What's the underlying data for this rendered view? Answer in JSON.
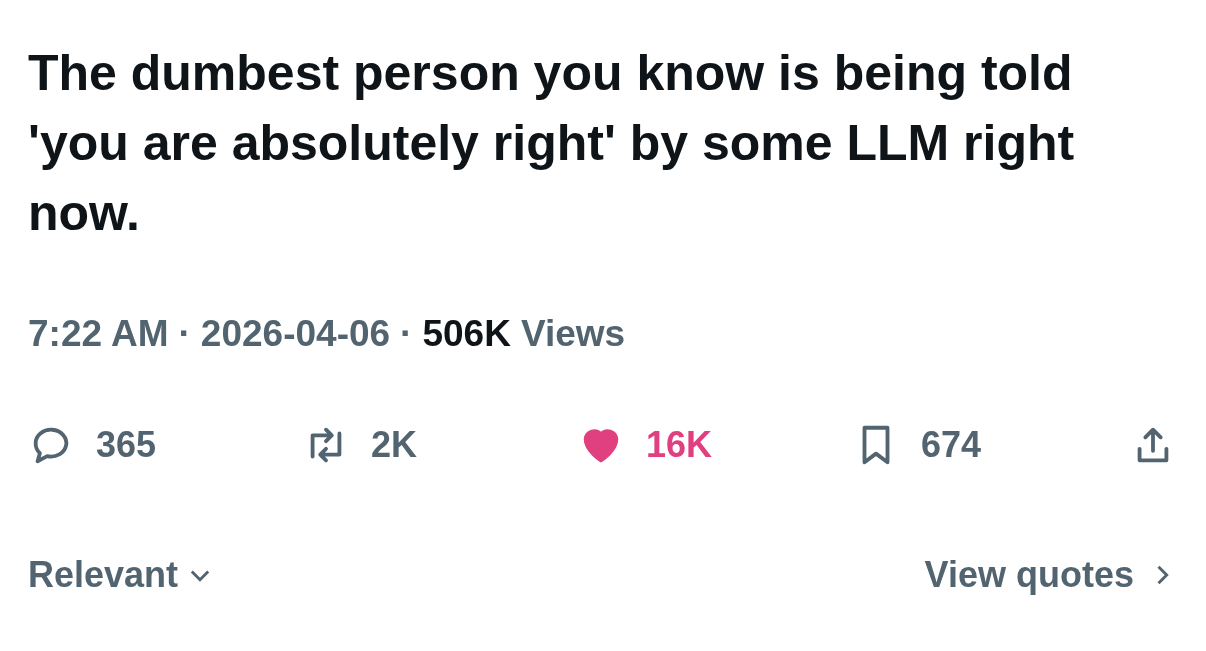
{
  "tweet": {
    "text": "The dumbest person you know is being told 'you are absolutely right' by some LLM right now."
  },
  "meta": {
    "time": "7:22 AM",
    "separator_1": "·",
    "date": "2026-04-06",
    "separator_2": "·",
    "views_count": "506K",
    "views_label": "Views"
  },
  "actions": [
    {
      "kind": "reply",
      "count": "365"
    },
    {
      "kind": "repost",
      "count": "2K"
    },
    {
      "kind": "like",
      "count": "16K",
      "active": true
    },
    {
      "kind": "bookmark",
      "count": "674",
      "active": false
    },
    {
      "kind": "share"
    }
  ],
  "footer": {
    "sort": "Relevant",
    "quotes": "View quotes"
  }
}
